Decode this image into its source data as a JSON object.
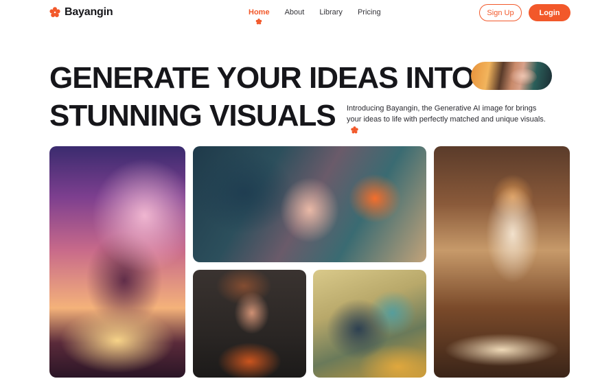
{
  "brand": {
    "name": "Bayangin",
    "accent": "#f2582a",
    "icon": "flower-icon"
  },
  "nav": {
    "items": [
      {
        "label": "Home",
        "active": true
      },
      {
        "label": "About",
        "active": false
      },
      {
        "label": "Library",
        "active": false
      },
      {
        "label": "Pricing",
        "active": false
      }
    ],
    "signup_label": "Sign Up",
    "login_label": "Login"
  },
  "hero": {
    "line1": "GENERATE YOUR IDEAS INTO",
    "line2": "STUNNING VISUALS",
    "description": "Introducing Bayangin, the Generative AI image for brings your ideas to life with perfectly matched and unique visuals."
  }
}
